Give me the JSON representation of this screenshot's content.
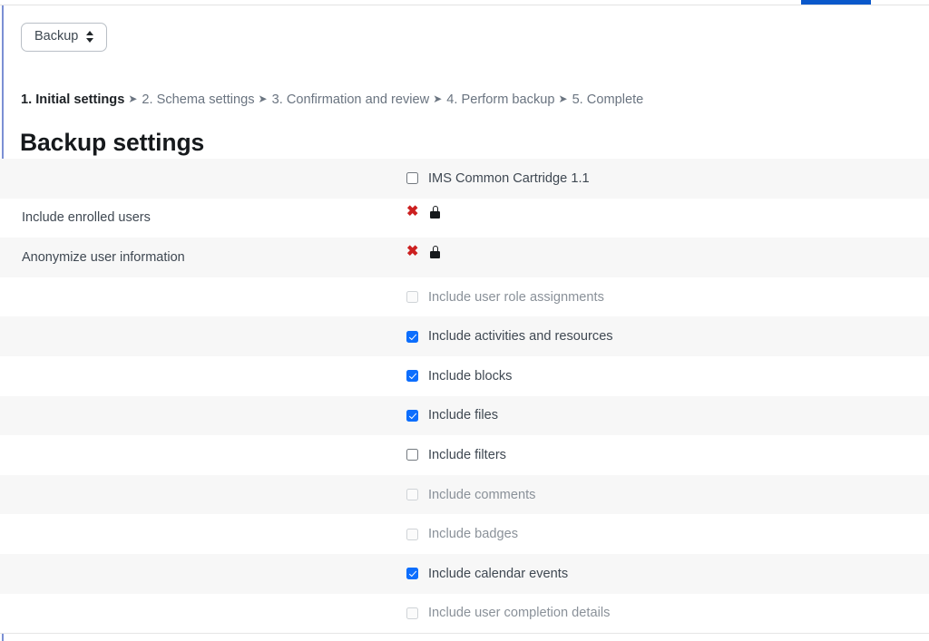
{
  "window": {
    "active_tab_accent": "#0a58ca",
    "left_rail_accent": "#7b8fd4"
  },
  "activity_selector": {
    "name": "activity-selector",
    "value": "Backup",
    "icon": "updown-chevron-icon"
  },
  "step_nav": {
    "separator": "➤",
    "steps": [
      {
        "label": "1. Initial settings",
        "current": true
      },
      {
        "label": "2. Schema settings",
        "current": false
      },
      {
        "label": "3. Confirmation and review",
        "current": false
      },
      {
        "label": "4. Perform backup",
        "current": false
      },
      {
        "label": "5. Complete",
        "current": false
      }
    ]
  },
  "heading": "Backup settings",
  "settings_table": {
    "locked_icons": {
      "x_mark": "✖",
      "x_color": "#cc2020",
      "padlock_icon": "padlock-icon"
    },
    "rows": [
      {
        "name": "ims-common-cartridge",
        "label": "",
        "control": "checkbox",
        "checkbox_label": "IMS Common Cartridge 1.1",
        "checked": false,
        "disabled": false
      },
      {
        "name": "include-enrolled-users",
        "label": "Include enrolled users",
        "control": "locked",
        "checkbox_label": "",
        "checked": false,
        "disabled": true
      },
      {
        "name": "anonymize-user-information",
        "label": "Anonymize user information",
        "control": "locked",
        "checkbox_label": "",
        "checked": false,
        "disabled": true
      },
      {
        "name": "include-user-role-assignments",
        "label": "",
        "control": "checkbox",
        "checkbox_label": "Include user role assignments",
        "checked": false,
        "disabled": true
      },
      {
        "name": "include-activities-and-resources",
        "label": "",
        "control": "checkbox",
        "checkbox_label": "Include activities and resources",
        "checked": true,
        "disabled": false
      },
      {
        "name": "include-blocks",
        "label": "",
        "control": "checkbox",
        "checkbox_label": "Include blocks",
        "checked": true,
        "disabled": false
      },
      {
        "name": "include-files",
        "label": "",
        "control": "checkbox",
        "checkbox_label": "Include files",
        "checked": true,
        "disabled": false
      },
      {
        "name": "include-filters",
        "label": "",
        "control": "checkbox",
        "checkbox_label": "Include filters",
        "checked": false,
        "disabled": false
      },
      {
        "name": "include-comments",
        "label": "",
        "control": "checkbox",
        "checkbox_label": "Include comments",
        "checked": false,
        "disabled": true
      },
      {
        "name": "include-badges",
        "label": "",
        "control": "checkbox",
        "checkbox_label": "Include badges",
        "checked": false,
        "disabled": true
      },
      {
        "name": "include-calendar-events",
        "label": "",
        "control": "checkbox",
        "checkbox_label": "Include calendar events",
        "checked": true,
        "disabled": false
      },
      {
        "name": "include-user-completion-details",
        "label": "",
        "control": "checkbox",
        "checkbox_label": "Include user completion details",
        "checked": false,
        "disabled": true
      }
    ]
  }
}
